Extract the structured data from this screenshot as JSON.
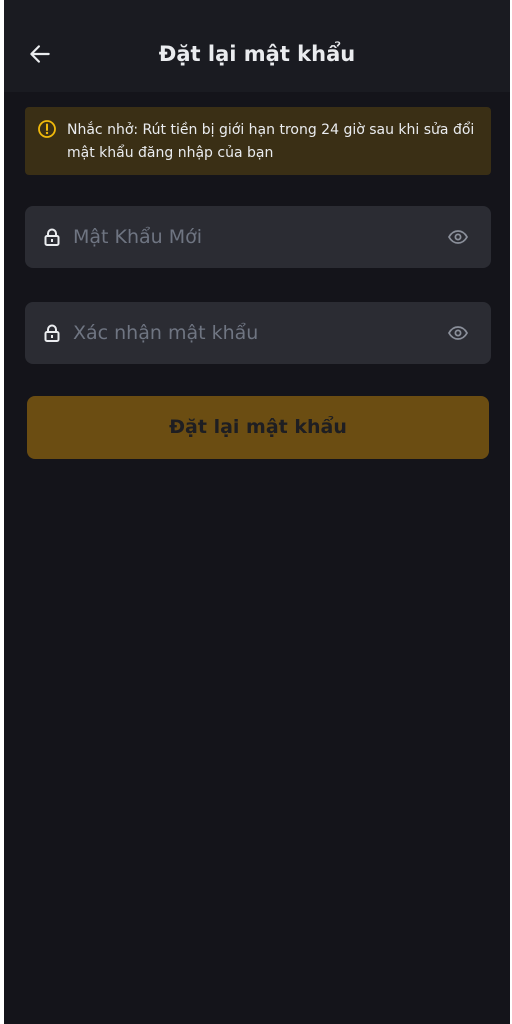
{
  "header": {
    "title": "Đặt lại mật khẩu",
    "back_icon": "arrow-left-icon"
  },
  "notice": {
    "icon": "warning-circle-icon",
    "text": "Nhắc nhở: Rút tiền bị giới hạn trong 24 giờ sau khi sửa đổi mật khẩu đăng nhập của bạn",
    "color": "#f0b90b"
  },
  "form": {
    "new_password": {
      "placeholder": "Mật Khẩu Mới",
      "value": "",
      "icon": "lock-icon",
      "toggle_icon": "eye-icon"
    },
    "confirm_password": {
      "placeholder": "Xác nhận mật khẩu",
      "value": "",
      "icon": "lock-icon",
      "toggle_icon": "eye-icon"
    },
    "submit_label": "Đặt lại mật khẩu"
  },
  "colors": {
    "background": "#14141a",
    "header": "#1a1b21",
    "field": "#2b2c33",
    "button": "#6b4d12",
    "notice_bg": "#3a2f15"
  }
}
